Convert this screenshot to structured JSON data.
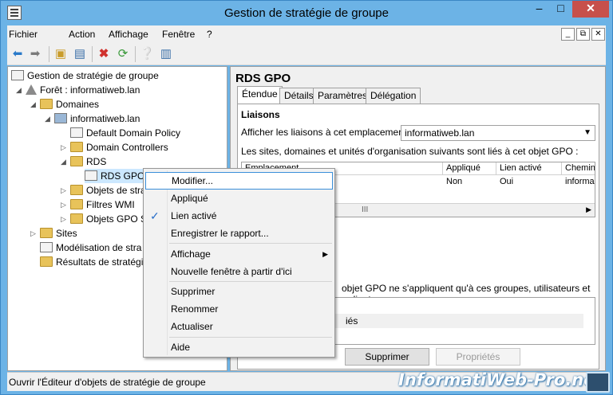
{
  "window": {
    "title": "Gestion de stratégie de groupe",
    "controls": {
      "minimize": "–",
      "maximize": "□",
      "close": "✕"
    }
  },
  "menu": [
    "Fichier",
    "Action",
    "Affichage",
    "Fenêtre",
    "?"
  ],
  "mdi_controls": {
    "minimize": "_",
    "restore": "⧉",
    "close": "✕"
  },
  "tree": {
    "root": "Gestion de stratégie de groupe",
    "forest": "Forêt : informatiweb.lan",
    "domains": "Domaines",
    "domain": "informatiweb.lan",
    "default_policy": "Default Domain Policy",
    "domain_controllers": "Domain Controllers",
    "rds_ou": "RDS",
    "rds_gpo": "RDS GPO",
    "gpo_objects": "Objets de stra",
    "wmi_filters": "Filtres WMI",
    "starter_gpo": "Objets GPO S",
    "sites": "Sites",
    "modeling": "Modélisation de stra",
    "results": "Résultats de stratégi"
  },
  "detail": {
    "title": "RDS GPO",
    "tabs": [
      "Étendue",
      "Détails",
      "Paramètres",
      "Délégation"
    ],
    "links_heading": "Liaisons",
    "location_label": "Afficher les liaisons à cet emplacement :",
    "location_value": "informatiweb.lan",
    "linked_label": "Les sites, domaines et unités d'organisation suivants sont liés à cet objet GPO :",
    "grid_headers": [
      "Emplacement",
      "Appliqué",
      "Lien activé",
      "Chemin"
    ],
    "grid_row": [
      "",
      "Non",
      "Oui",
      "informa"
    ],
    "scroll_thumb": "III",
    "filter_text": "objet GPO ne s'appliquent qu'à ces groupes, utilisateurs et ordinateurs :",
    "filter_item": "iés",
    "buttons": {
      "delete": "Supprimer",
      "properties": "Propriétés"
    }
  },
  "context_menu": {
    "edit": "Modifier...",
    "enforced": "Appliqué",
    "link_enabled": "Lien activé",
    "save_report": "Enregistrer le rapport...",
    "view": "Affichage",
    "new_window": "Nouvelle fenêtre à partir d'ici",
    "delete": "Supprimer",
    "rename": "Renommer",
    "refresh": "Actualiser",
    "help": "Aide"
  },
  "status": "Ouvrir l'Éditeur d'objets de stratégie de groupe",
  "watermark": "InformatiWeb-Pro.net",
  "colors": {
    "titlebar": "#6cb3e6",
    "close": "#c7504b",
    "highlight": "#3a8fd9"
  }
}
